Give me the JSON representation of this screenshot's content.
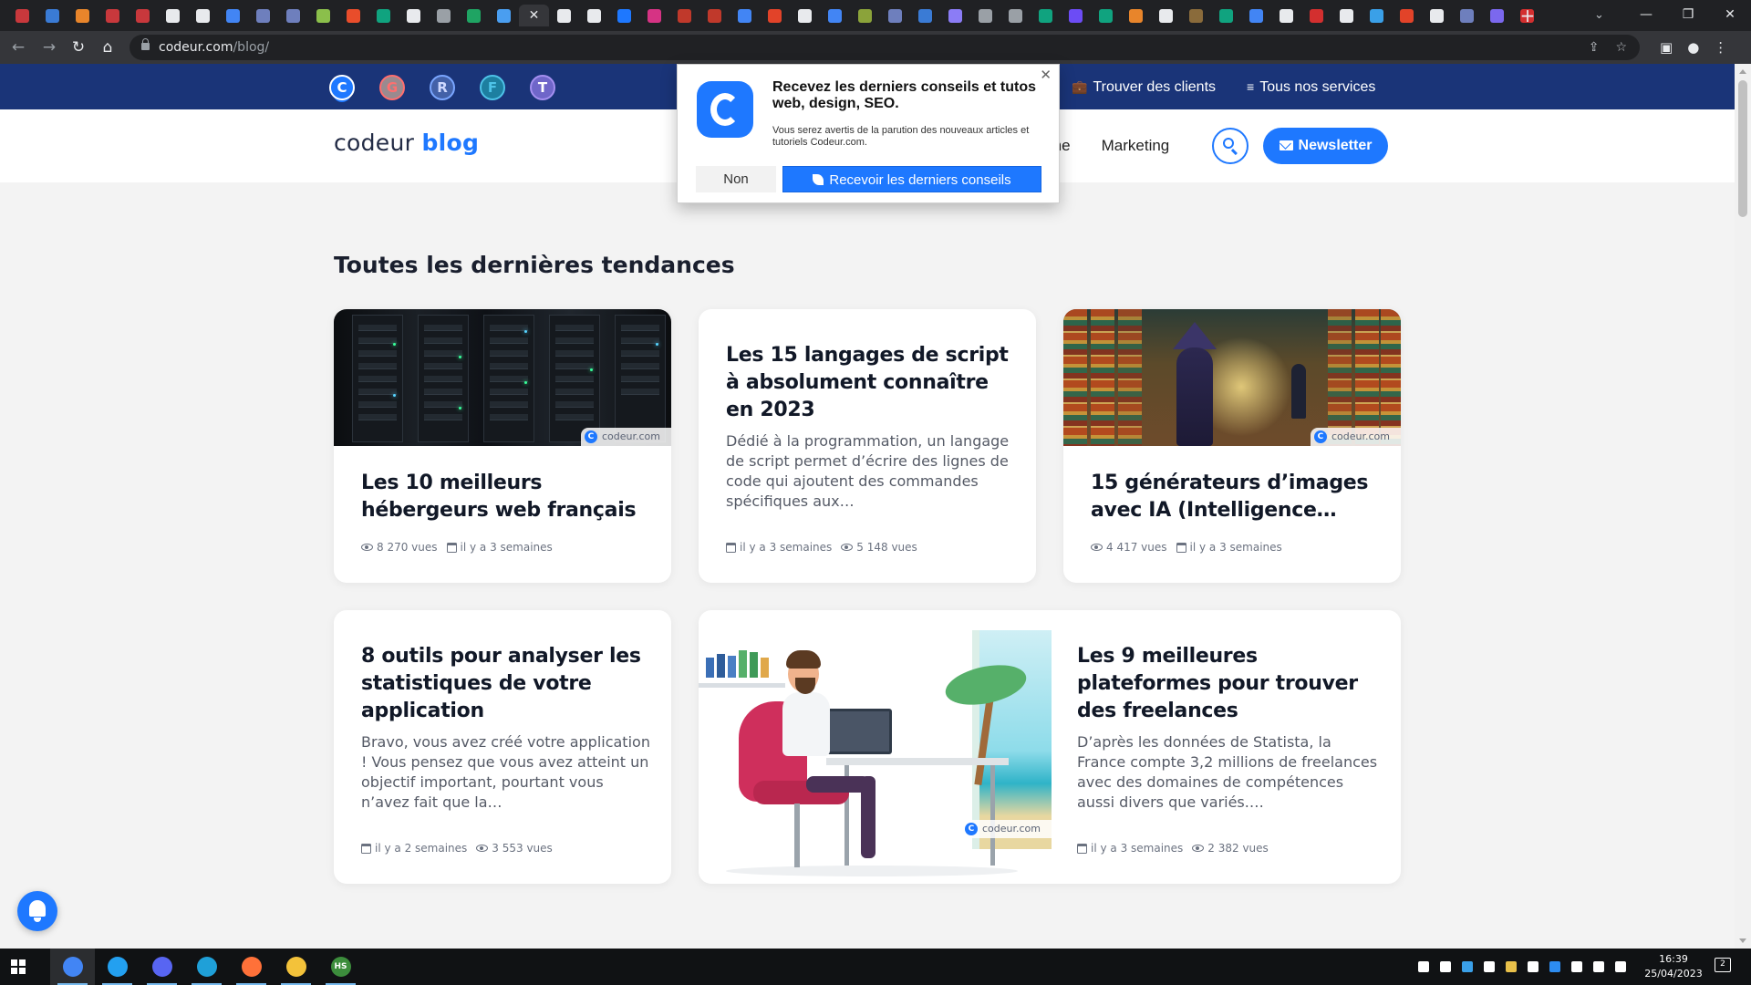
{
  "browser": {
    "tab_favicon_colors": [
      "#c8383c",
      "#3a7bd5",
      "#e8852b",
      "#c8383c",
      "#c8383c",
      "#e8eaed",
      "#e8eaed",
      "#4285f4",
      "#6e7fbd",
      "#6e7fbd",
      "#8bbf4b",
      "#e94d2b",
      "#10a37f",
      "#e8eaed",
      "#9aa0a6",
      "#1fa463",
      "#4a9ef0",
      "#e8eaed",
      "#e8eaed",
      "#1e78ff",
      "#d63384",
      "#c0392b",
      "#c0392b",
      "#4285f4",
      "#e24329",
      "#e8eaed",
      "#4285f4",
      "#8ba33a",
      "#6e7fbd",
      "#3a7bd5",
      "#8b7cf6",
      "#9aa0a6",
      "#9aa0a6",
      "#10a37f",
      "#6c4cf5",
      "#10a37f",
      "#e8852b",
      "#e8eaed",
      "#8a6b3b",
      "#10a37f",
      "#4285f4",
      "#e8eaed",
      "#d32f2f",
      "#e8eaed",
      "#3aa0e8",
      "#e24329",
      "#e8eaed",
      "#6e7fbd",
      "#7b68ee",
      "#d32f2f"
    ],
    "active_tab_glyph": "✕",
    "new_tab_glyph": "+",
    "tab_search_glyph": "⌄",
    "window_controls": [
      "—",
      "❐",
      "✕"
    ],
    "nav": {
      "back": "←",
      "forward": "→",
      "reload": "↻",
      "home": "⌂"
    },
    "url_host": "codeur.com",
    "url_path": "/blog/",
    "omnibox_icons": [
      "⇪",
      "☆"
    ],
    "toolbar_icons": [
      "▣",
      "●",
      "⋮"
    ]
  },
  "site": {
    "colors": {
      "topbar": "#1a3478",
      "accent": "#1e78ff",
      "page_bg": "#f3f3f3"
    },
    "network_brands": [
      "C",
      "G",
      "R",
      "F",
      "T"
    ],
    "topbar_links": [
      {
        "icon": "💼",
        "label": "Trouver des clients"
      },
      {
        "icon": "≡",
        "label": "Tous nos services"
      }
    ],
    "logo": {
      "part1": "codeur",
      "part2": "blog"
    },
    "nav_links": [
      "me",
      "Marketing"
    ],
    "newsletter_label": "Newsletter",
    "section_title": "Toutes les dernières tendances",
    "watermark": "codeur.com",
    "articles": [
      {
        "title": "Les 10 meilleurs hébergeurs web français",
        "image": "server-racks",
        "meta": [
          {
            "icon": "eye",
            "text": "8 270 vues"
          },
          {
            "icon": "calendar",
            "text": "il y a 3 semaines"
          }
        ]
      },
      {
        "title": "Les 15 langages de script à absolument connaître en 2023",
        "excerpt": "Dédié à la programmation, un langage de script permet d’écrire des lignes de code qui ajoutent des commandes spécifiques aux…",
        "meta": [
          {
            "icon": "calendar",
            "text": "il y a 3 semaines"
          },
          {
            "icon": "eye",
            "text": "5 148 vues"
          }
        ]
      },
      {
        "title": "15 générateurs d’images avec IA (Intelligence…",
        "image": "library-wizard",
        "meta": [
          {
            "icon": "eye",
            "text": "4 417 vues"
          },
          {
            "icon": "calendar",
            "text": "il y a 3 semaines"
          }
        ]
      },
      {
        "title": "8 outils pour analyser les statistiques de votre application",
        "excerpt": "Bravo, vous avez créé votre application ! Vous pensez que vous avez atteint un objectif important, pourtant vous n’avez fait que la…",
        "meta": [
          {
            "icon": "calendar",
            "text": "il y a 2 semaines"
          },
          {
            "icon": "eye",
            "text": "3 553 vues"
          }
        ]
      },
      {
        "title": "Les 9 meilleures plateformes pour trouver des freelances",
        "excerpt": "D’après les données de Statista, la France compte 3,2 millions de freelances avec des domaines de compétences aussi divers que variés.…",
        "image": "freelancer-at-desk",
        "meta": [
          {
            "icon": "calendar",
            "text": "il y a 3 semaines"
          },
          {
            "icon": "eye",
            "text": "2 382 vues"
          }
        ]
      }
    ]
  },
  "popup": {
    "close": "✕",
    "title": "Recevez les derniers conseils et tutos web, design, SEO.",
    "text": "Vous serez avertis de la parution des nouveaux articles et tutoriels Codeur.com.",
    "no_label": "Non",
    "yes_label": "Recevoir les derniers conseils"
  },
  "taskbar": {
    "apps": [
      {
        "name": "chrome",
        "color": "#4285f4",
        "open": true,
        "active": true
      },
      {
        "name": "vscode",
        "color": "#23a0f0",
        "open": true
      },
      {
        "name": "discord",
        "color": "#5865f2",
        "open": true
      },
      {
        "name": "edge",
        "color": "#1fa0d8",
        "open": true
      },
      {
        "name": "firefox",
        "color": "#ff7139",
        "open": true
      },
      {
        "name": "explorer",
        "color": "#f3c23a",
        "open": true
      },
      {
        "name": "hs-app",
        "color": "#3c8d3c",
        "open": true
      }
    ],
    "hs_label": "HS",
    "tray_colors": [
      "#ffffff",
      "#ffffff",
      "#3aa0e8",
      "#ffffff",
      "#e8c04a",
      "#ffffff",
      "#2d8cf0",
      "#ffffff",
      "#ffffff",
      "#ffffff"
    ],
    "time": "16:39",
    "date": "25/04/2023",
    "notification_count": "2"
  }
}
